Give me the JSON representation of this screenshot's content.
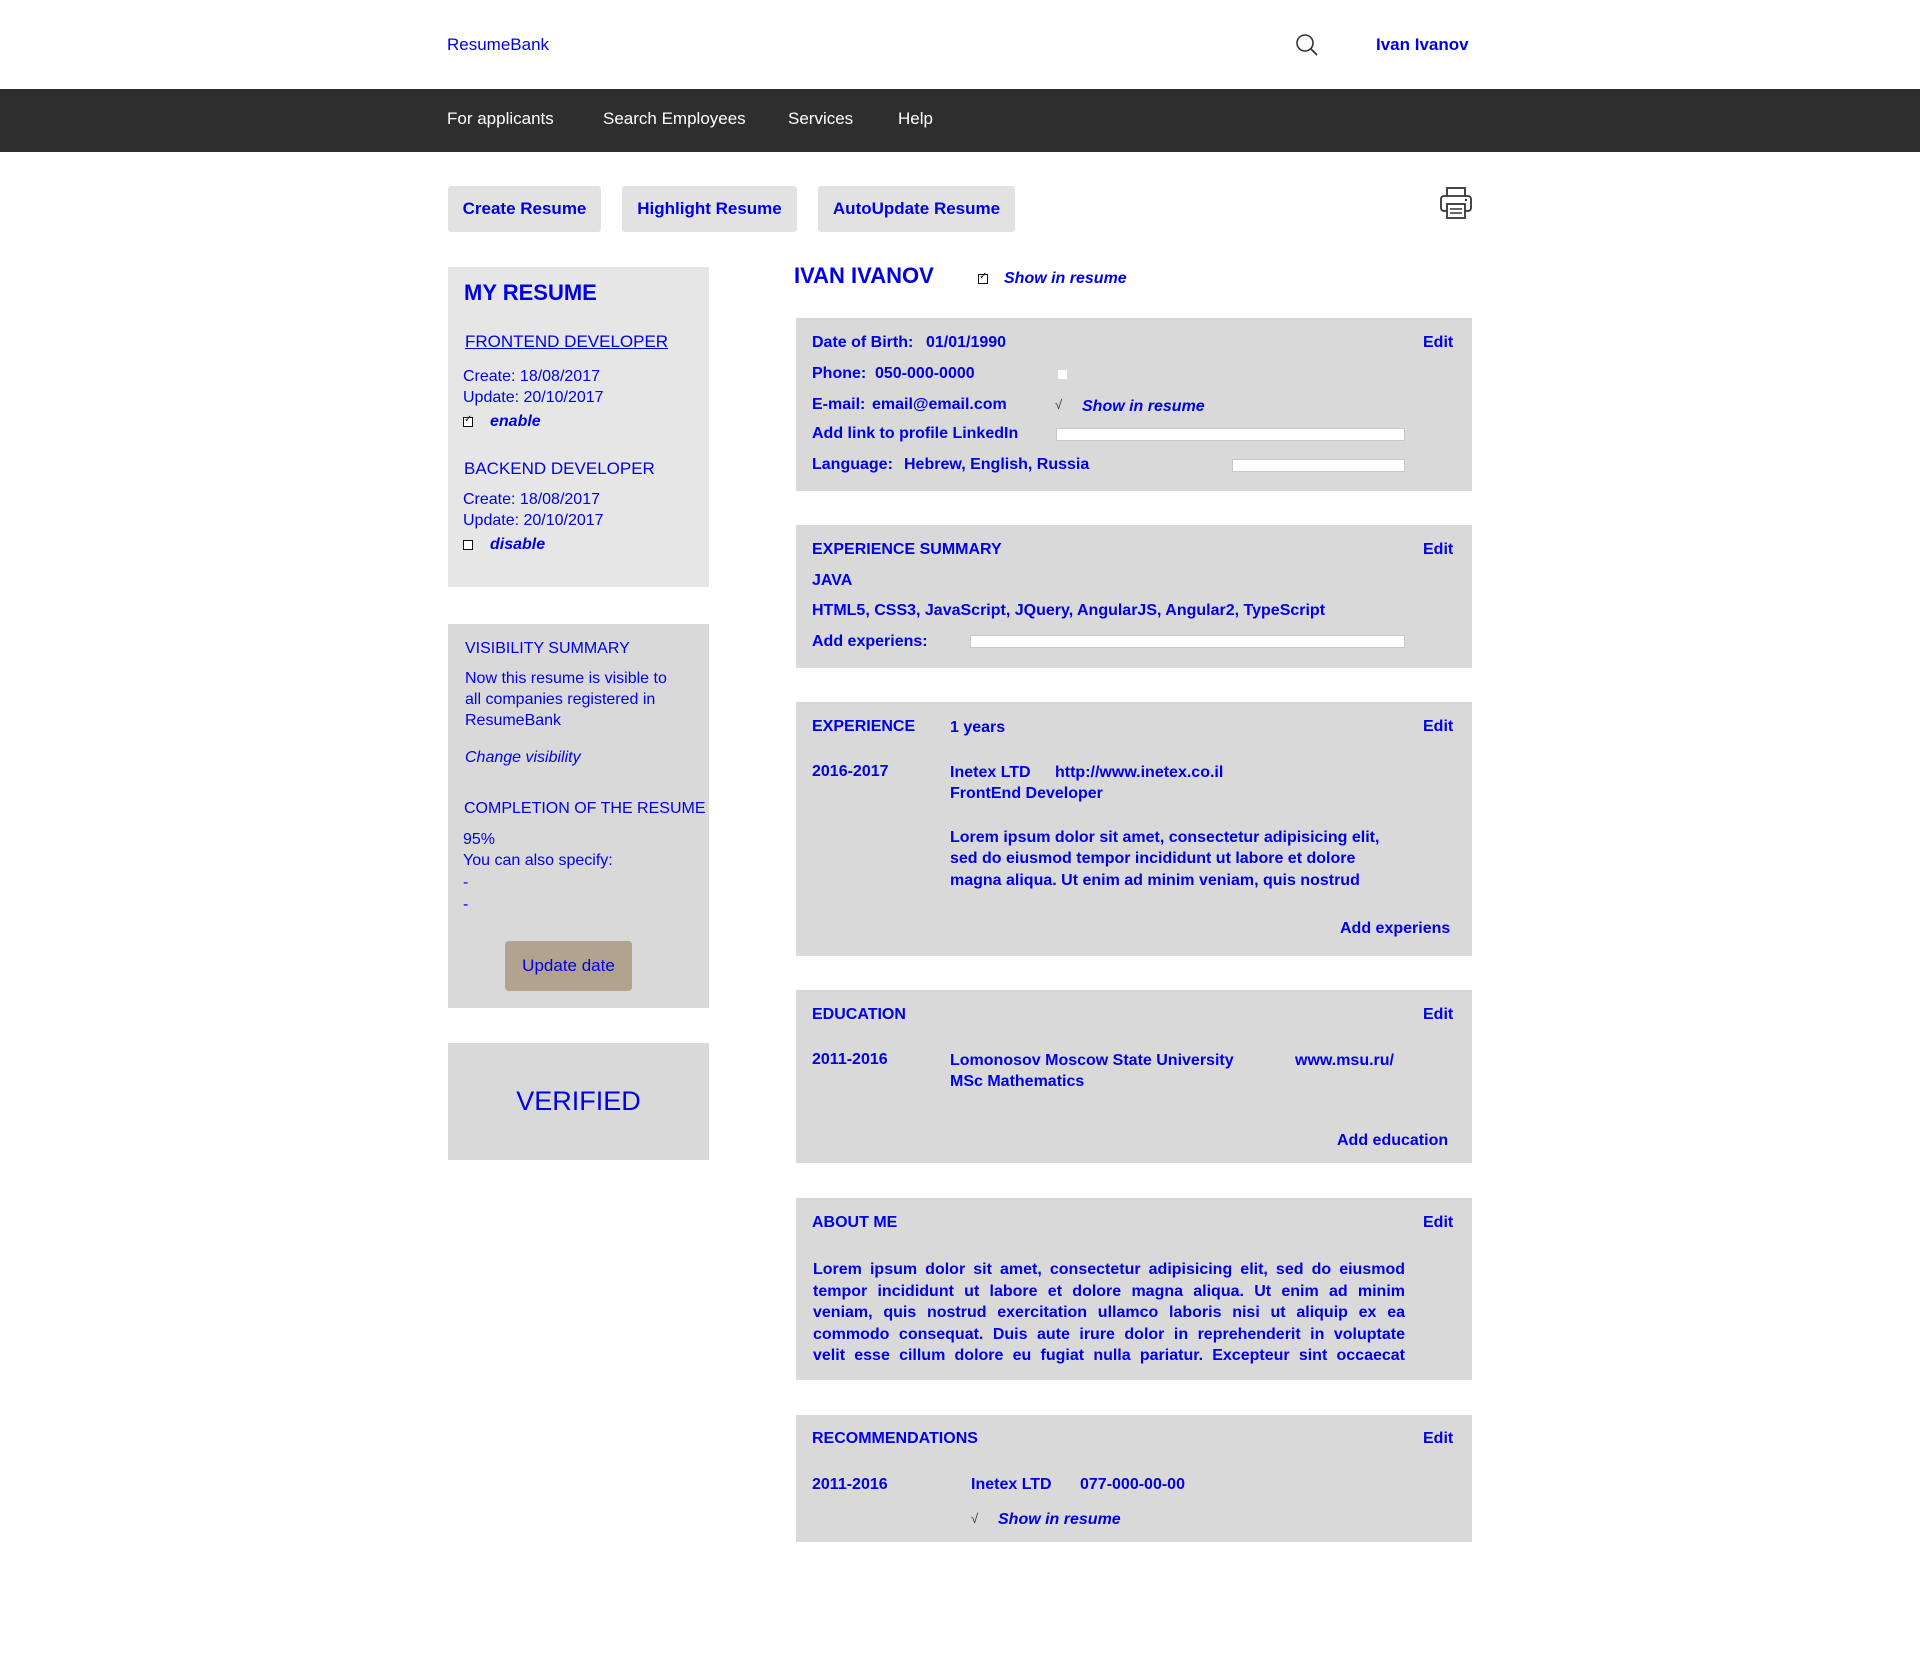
{
  "header": {
    "logo": "ResumeBank",
    "user_name": "Ivan Ivanov"
  },
  "nav": {
    "items": [
      "For applicants",
      "Search Employees",
      "Services",
      "Help"
    ]
  },
  "actions": {
    "create": "Create Resume",
    "highlight": "Highlight Resume",
    "autoupdate": "AutoUpdate Resume"
  },
  "my_resume": {
    "title": "MY RESUME",
    "resumes": [
      {
        "name": "FRONTEND DEVELOPER",
        "create": "Create: 18/08/2017",
        "update": "Update: 20/10/2017",
        "status": "enable",
        "checked": true
      },
      {
        "name": "BACKEND DEVELOPER",
        "create": "Create: 18/08/2017",
        "update": "Update: 20/10/2017",
        "status": "disable",
        "checked": false
      }
    ]
  },
  "visibility": {
    "title": "VISIBILITY SUMMARY",
    "text_lines": [
      "Now this resume is visible to",
      "all companies registered in",
      "ResumeBank"
    ],
    "change_link": "Change visibility",
    "completion_title": "COMPLETION OF THE RESUME",
    "completion_percent": "95%",
    "specify": "You can also specify:",
    "dash1": "-",
    "dash2": "-",
    "update_button": "Update date"
  },
  "verified": "VERIFIED",
  "profile": {
    "name": "IVAN IVANOV",
    "show_in_resume": "Show in resume",
    "edit": "Edit",
    "dob_label": "Date of Birth:",
    "dob_value": "01/01/1990",
    "phone_label": "Phone:",
    "phone_value": "050-000-0000",
    "email_label": "E-mail:",
    "email_value": "email@email.com",
    "email_show": "Show in resume",
    "linkedin_label": "Add link to profile LinkedIn",
    "language_label": "Language:",
    "language_value": "Hebrew, English, Russia"
  },
  "experience_summary": {
    "title": "EXPERIENCE SUMMARY",
    "edit": "Edit",
    "line1": "JAVA",
    "line2": "HTML5, CSS3, JavaScript, JQuery, AngularJS, Angular2, TypeScript",
    "add_label": "Add experiens:"
  },
  "experience": {
    "title": "EXPERIENCE",
    "duration": "1 years",
    "edit": "Edit",
    "period": "2016-2017",
    "company": "Inetex LTD",
    "url": "http://www.inetex.co.il",
    "role": "FrontEnd Developer",
    "desc_lines": [
      "Lorem ipsum dolor sit amet, consectetur adipisicing elit,",
      "sed do eiusmod tempor incididunt ut labore et dolore",
      "magna aliqua. Ut enim ad minim veniam, quis nostrud"
    ],
    "add": "Add experiens"
  },
  "education": {
    "title": "EDUCATION",
    "edit": "Edit",
    "period": "2011-2016",
    "school": "Lomonosov Moscow State University",
    "url": "www.msu.ru/",
    "degree": "MSc Mathematics",
    "add": "Add education"
  },
  "about": {
    "title": "ABOUT ME",
    "edit": "Edit",
    "text_lines": [
      "Lorem ipsum dolor sit amet, consectetur adipisicing elit, sed do eiusmod",
      "tempor incididunt ut labore et dolore magna aliqua. Ut enim ad minim",
      "veniam, quis nostrud exercitation ullamco laboris nisi ut aliquip ex ea",
      "commodo consequat. Duis aute irure dolor in reprehenderit in voluptate",
      "velit esse cillum dolore eu fugiat nulla pariatur. Excepteur sint occaecat"
    ]
  },
  "recommendations": {
    "title": "RECOMMENDATIONS",
    "edit": "Edit",
    "period": "2011-2016",
    "company": "Inetex LTD",
    "phone": "077-000-00-00",
    "show": "Show in resume"
  }
}
